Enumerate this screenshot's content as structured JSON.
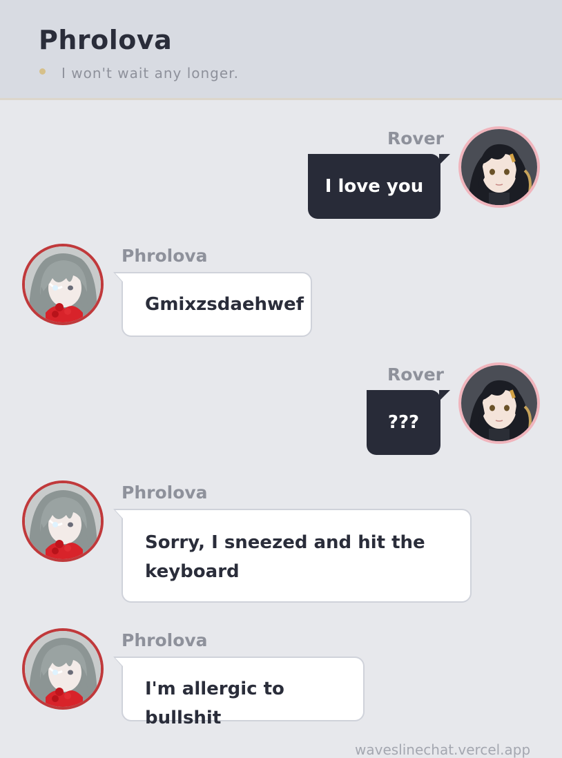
{
  "header": {
    "title": "Phrolova",
    "status": "I won't wait any longer.",
    "status_dot_color": "#d6c08a"
  },
  "messages": [
    {
      "sender": "Rover",
      "side": "right",
      "text": "I love you",
      "avatar_icon": "rover-avatar"
    },
    {
      "sender": "Phrolova",
      "side": "left",
      "text": "Gmixzsdaehwef",
      "avatar_icon": "phrolova-avatar"
    },
    {
      "sender": "Rover",
      "side": "right",
      "text": "???",
      "avatar_icon": "rover-avatar"
    },
    {
      "sender": "Phrolova",
      "side": "left",
      "text": "Sorry, I sneezed and hit the keyboard",
      "avatar_icon": "phrolova-avatar"
    },
    {
      "sender": "Phrolova",
      "side": "left",
      "text": "I'm allergic to bullshit",
      "avatar_icon": "phrolova-avatar"
    }
  ],
  "footer": {
    "watermark": "waveslinechat.vercel.app"
  },
  "colors": {
    "background": "#e7e8ec",
    "header_bg": "#d8dbe2",
    "outgoing_bubble": "#282b38",
    "incoming_bubble": "#ffffff",
    "rover_ring": "#f0b4bc",
    "phrolova_ring": "#c0393b"
  }
}
